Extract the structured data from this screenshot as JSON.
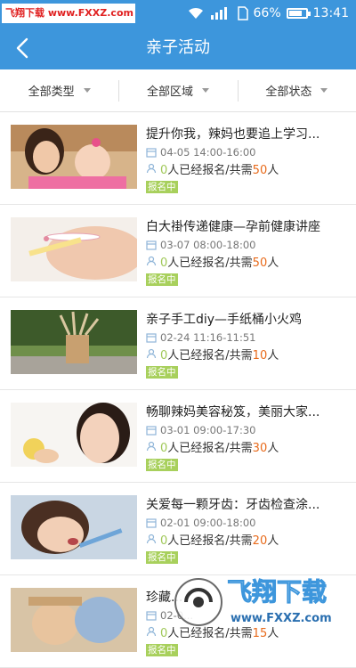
{
  "statusbar": {
    "watermark": "飞翔下载 www.FXXZ.com",
    "battery": "66%",
    "time": "13:41"
  },
  "header": {
    "title": "亲子活动"
  },
  "filters": [
    {
      "label": "全部类型"
    },
    {
      "label": "全部区域"
    },
    {
      "label": "全部状态"
    }
  ],
  "colors": {
    "accent": "#3d96dc",
    "highlight": "#a0c858",
    "number": "#e86b1c",
    "badge": "#a8d05c"
  },
  "activities": [
    {
      "title": "提升你我，辣妈也要追上学习...",
      "time": "04-05 14:00-16:00",
      "enrolled": "0",
      "enroll_mid": "人已经报名/共需",
      "total": "50",
      "unit": "人",
      "status": "报名中"
    },
    {
      "title": "白大褂传递健康—孕前健康讲座",
      "time": "03-07 08:00-18:00",
      "enrolled": "0",
      "enroll_mid": "人已经报名/共需",
      "total": "50",
      "unit": "人",
      "status": "报名中"
    },
    {
      "title": "亲子手工diy—手纸桶小火鸡",
      "time": "02-24 11:16-11:51",
      "enrolled": "0",
      "enroll_mid": "人已经报名/共需",
      "total": "10",
      "unit": "人",
      "status": "报名中"
    },
    {
      "title": "畅聊辣妈美容秘笈，美丽大家...",
      "time": "03-01 09:00-17:30",
      "enrolled": "0",
      "enroll_mid": "人已经报名/共需",
      "total": "30",
      "unit": "人",
      "status": "报名中"
    },
    {
      "title": "关爱每一颗牙齿：牙齿检查涂...",
      "time": "02-01 09:00-18:00",
      "enrolled": "0",
      "enroll_mid": "人已经报名/共需",
      "total": "20",
      "unit": "人",
      "status": "报名中"
    },
    {
      "title": "珍藏...",
      "time": "02-0...",
      "enrolled": "0",
      "enroll_mid": "人已经报名/共需",
      "total": "15",
      "unit": "人",
      "status": "报名中"
    }
  ],
  "watermark_logo": {
    "text": "飞翔下载",
    "url": "www.FXXZ.com"
  }
}
